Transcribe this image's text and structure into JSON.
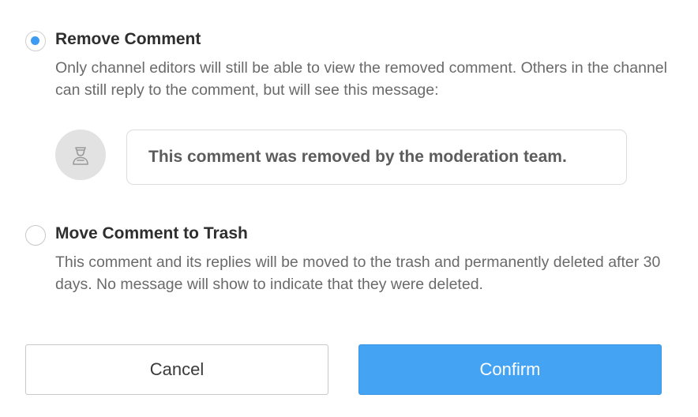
{
  "options": {
    "remove": {
      "title": "Remove Comment",
      "description": "Only channel editors will still be able to view the removed comment. Others in the channel can still reply to the comment, but will see this message:",
      "selected": true
    },
    "trash": {
      "title": "Move Comment to Trash",
      "description": "This comment and its replies will be moved to the trash and permanently deleted after 30 days. No message will show to indicate that they were deleted.",
      "selected": false
    }
  },
  "preview": {
    "avatar_icon": "moderator-user-icon",
    "message": "This comment was removed by the moderation team."
  },
  "buttons": {
    "cancel_label": "Cancel",
    "confirm_label": "Confirm"
  },
  "colors": {
    "accent": "#44a3f3",
    "radio_dot": "#3d9bf2"
  }
}
